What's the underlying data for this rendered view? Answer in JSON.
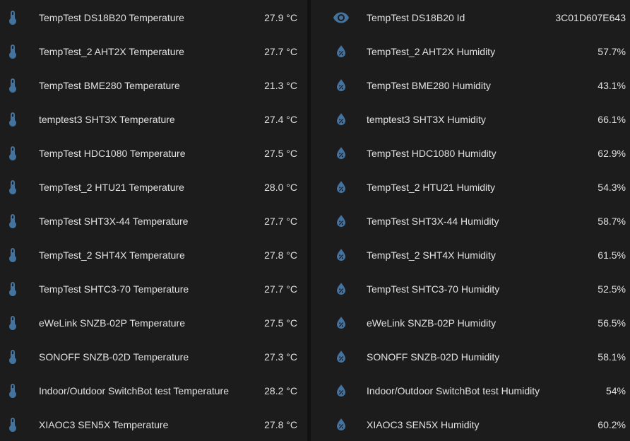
{
  "colors": {
    "background": "#111111",
    "card": "#1c1c1c",
    "icon": "#44739e",
    "text": "#e1e1e1"
  },
  "left_card": {
    "rows": [
      {
        "icon": "thermometer-icon",
        "name": "TempTest DS18B20 Temperature",
        "state": "27.9 °C"
      },
      {
        "icon": "thermometer-icon",
        "name": "TempTest_2 AHT2X Temperature",
        "state": "27.7 °C"
      },
      {
        "icon": "thermometer-icon",
        "name": "TempTest BME280 Temperature",
        "state": "21.3 °C"
      },
      {
        "icon": "thermometer-icon",
        "name": "temptest3 SHT3X Temperature",
        "state": "27.4 °C"
      },
      {
        "icon": "thermometer-icon",
        "name": "TempTest HDC1080 Temperature",
        "state": "27.5 °C"
      },
      {
        "icon": "thermometer-icon",
        "name": "TempTest_2 HTU21 Temperature",
        "state": "28.0 °C"
      },
      {
        "icon": "thermometer-icon",
        "name": "TempTest SHT3X-44 Temperature",
        "state": "27.7 °C"
      },
      {
        "icon": "thermometer-icon",
        "name": "TempTest_2 SHT4X Temperature",
        "state": "27.8 °C"
      },
      {
        "icon": "thermometer-icon",
        "name": "TempTest SHTC3-70 Temperature",
        "state": "27.7 °C"
      },
      {
        "icon": "thermometer-icon",
        "name": "eWeLink SNZB-02P Temperature",
        "state": "27.5 °C"
      },
      {
        "icon": "thermometer-icon",
        "name": "SONOFF SNZB-02D Temperature",
        "state": "27.3 °C"
      },
      {
        "icon": "thermometer-icon",
        "name": "Indoor/Outdoor SwitchBot test Temperature",
        "state": "28.2 °C"
      },
      {
        "icon": "thermometer-icon",
        "name": "XIAOC3 SEN5X Temperature",
        "state": "27.8 °C"
      }
    ]
  },
  "right_card": {
    "rows": [
      {
        "icon": "eye-icon",
        "name": "TempTest DS18B20 Id",
        "state": "3C01D607E643"
      },
      {
        "icon": "water-percent-icon",
        "name": "TempTest_2 AHT2X Humidity",
        "state": "57.7%"
      },
      {
        "icon": "water-percent-icon",
        "name": "TempTest BME280 Humidity",
        "state": "43.1%"
      },
      {
        "icon": "water-percent-icon",
        "name": "temptest3 SHT3X Humidity",
        "state": "66.1%"
      },
      {
        "icon": "water-percent-icon",
        "name": "TempTest HDC1080 Humidity",
        "state": "62.9%"
      },
      {
        "icon": "water-percent-icon",
        "name": "TempTest_2 HTU21 Humidity",
        "state": "54.3%"
      },
      {
        "icon": "water-percent-icon",
        "name": "TempTest SHT3X-44 Humidity",
        "state": "58.7%"
      },
      {
        "icon": "water-percent-icon",
        "name": "TempTest_2 SHT4X Humidity",
        "state": "61.5%"
      },
      {
        "icon": "water-percent-icon",
        "name": "TempTest SHTC3-70 Humidity",
        "state": "52.5%"
      },
      {
        "icon": "water-percent-icon",
        "name": "eWeLink SNZB-02P Humidity",
        "state": "56.5%"
      },
      {
        "icon": "water-percent-icon",
        "name": "SONOFF SNZB-02D Humidity",
        "state": "58.1%"
      },
      {
        "icon": "water-percent-icon",
        "name": "Indoor/Outdoor SwitchBot test Humidity",
        "state": "54%"
      },
      {
        "icon": "water-percent-icon",
        "name": "XIAOC3 SEN5X Humidity",
        "state": "60.2%"
      }
    ]
  }
}
